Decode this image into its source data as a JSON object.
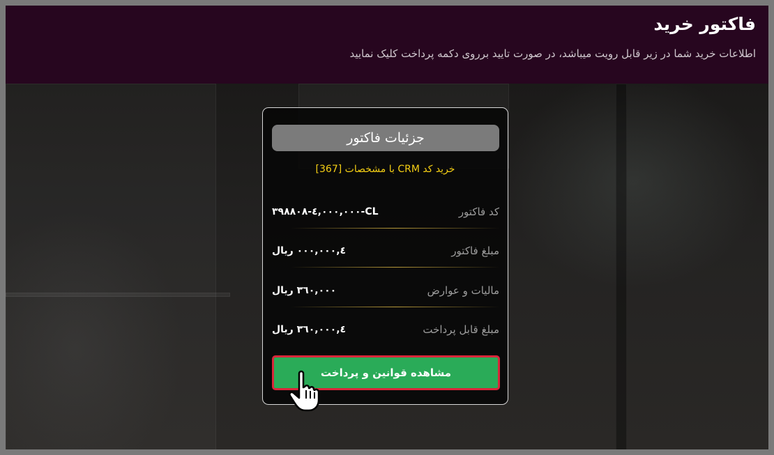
{
  "header": {
    "title": "فاکتور خرید",
    "subtitle": "اطلاعات خرید شما در زیر قابل رویت میباشد، در صورت تایید برروی دکمه پرداخت کلیک نمایید"
  },
  "invoice": {
    "title": "جزئیات فاکتور",
    "subtitle": "خرید کد CRM با مشخصات [367]",
    "rows": [
      {
        "label": "کد فاکتور",
        "value": "۳۹۸۸۰۸-٤,۰۰۰,۰۰۰-CL"
      },
      {
        "label": "مبلغ فاکتور",
        "value": "٤,۰۰۰,۰۰۰ ریال"
      },
      {
        "label": "مالیات و عوارض",
        "value": "۳٦۰,۰۰۰ ریال"
      },
      {
        "label": "مبلغ قابل پرداخت",
        "value": "٤,۳٦۰,۰۰۰ ریال"
      }
    ],
    "pay_button": "مشاهده قوانین و پرداخت"
  },
  "colors": {
    "header_bg": "#27061f",
    "accent_yellow": "#f4ce14",
    "button_green": "#2aab58",
    "button_border_red": "#d9263a",
    "separator_gold": "#b89a3a"
  },
  "icons": {
    "pointer": "hand-pointer-icon"
  }
}
